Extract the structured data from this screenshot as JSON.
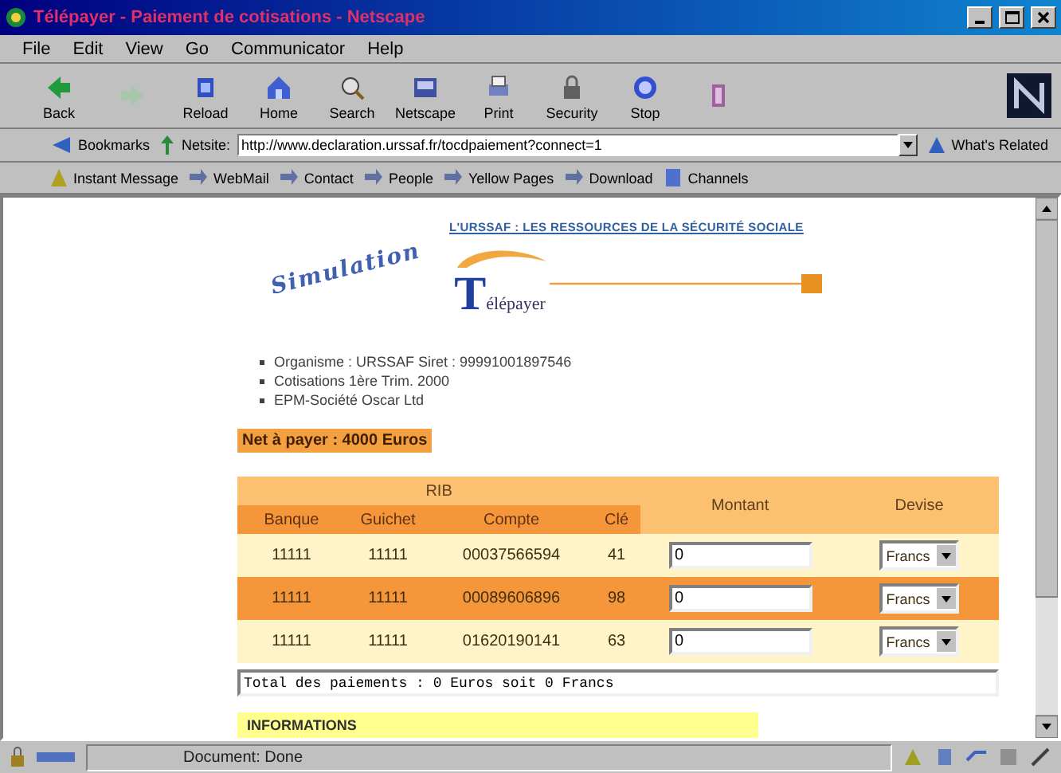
{
  "window": {
    "title": "Télépayer - Paiement de cotisations - Netscape"
  },
  "menu": [
    {
      "label": "File"
    },
    {
      "label": "Edit"
    },
    {
      "label": "View"
    },
    {
      "label": "Go"
    },
    {
      "label": "Communicator"
    },
    {
      "label": "Help"
    }
  ],
  "toolbar": [
    {
      "label": "Back",
      "disabled": false
    },
    {
      "disabled": true
    },
    {
      "label": "Reload",
      "disabled": false
    },
    {
      "label": "Home",
      "disabled": false
    },
    {
      "label": "Search",
      "disabled": false
    },
    {
      "label": "Netscape",
      "disabled": false
    },
    {
      "label": "Print",
      "disabled": false
    },
    {
      "label": "Security",
      "disabled": false
    },
    {
      "label": "Stop",
      "disabled": false
    },
    {
      "disabled": false
    }
  ],
  "location_bar": {
    "bookmarks": "Bookmarks",
    "location_label": "Netsite:",
    "url": "http://www.declaration.urssaf.fr/tocdpaiement?connect=1",
    "related": "What's Related"
  },
  "personal_toolbar": [
    {
      "label": "Instant Message"
    },
    {
      "label": "WebMail"
    },
    {
      "label": "Contact"
    },
    {
      "label": "People"
    },
    {
      "label": "Yellow Pages"
    },
    {
      "label": "Download"
    },
    {
      "label": "Channels"
    }
  ],
  "page": {
    "header_link": "L'URSSAF : LES RESSOURCES DE LA SÉCURITÉ SOCIALE",
    "tagline": "Simulation",
    "logo": "Télépayer",
    "details": [
      "Organisme : URSSAF Siret : 99991001897546",
      "Cotisations 1ère Trim. 2000",
      "EPM-Société Oscar Ltd"
    ],
    "net_to_pay": "Net à payer : 4000 Euros",
    "table": {
      "group": "RIB",
      "columns": [
        "Banque",
        "Guichet",
        "Compte",
        "Clé",
        "Montant",
        "Devise"
      ],
      "rows": [
        {
          "bank": "11111",
          "branch": "11111",
          "account": "00037566594",
          "key": "41",
          "amount": "0",
          "currency": "Francs",
          "highlighted": false
        },
        {
          "bank": "11111",
          "branch": "11111",
          "account": "00089606896",
          "key": "98",
          "amount": "0",
          "currency": "Francs",
          "highlighted": true
        },
        {
          "bank": "11111",
          "branch": "11111",
          "account": "01620190141",
          "key": "63",
          "amount": "0",
          "currency": "Francs",
          "highlighted": false
        }
      ]
    },
    "total": "Total des paiements : 0 Euros soit 0 Francs",
    "section": "INFORMATIONS"
  },
  "status_bar": {
    "text": "Document: Done"
  }
}
